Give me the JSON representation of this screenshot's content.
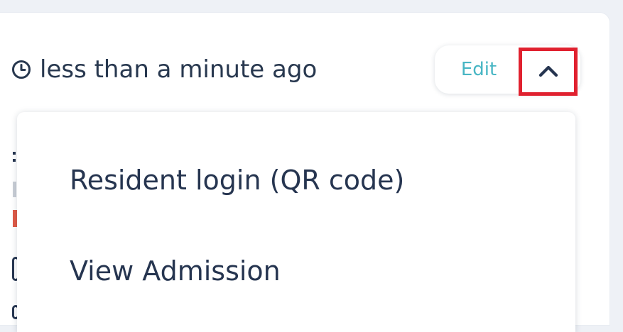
{
  "header": {
    "timestamp": "less than a minute ago",
    "timestamp_icon": "clock-icon"
  },
  "actions": {
    "edit_label": "Edit",
    "toggle_icon": "chevron-up-icon"
  },
  "menu": {
    "items": [
      {
        "label": "Resident login (QR code)"
      },
      {
        "label": "View Admission"
      }
    ]
  },
  "colors": {
    "text": "#28384f",
    "edit": "#48b6c4",
    "highlight": "#e0212f",
    "background": "#eef1f6"
  }
}
